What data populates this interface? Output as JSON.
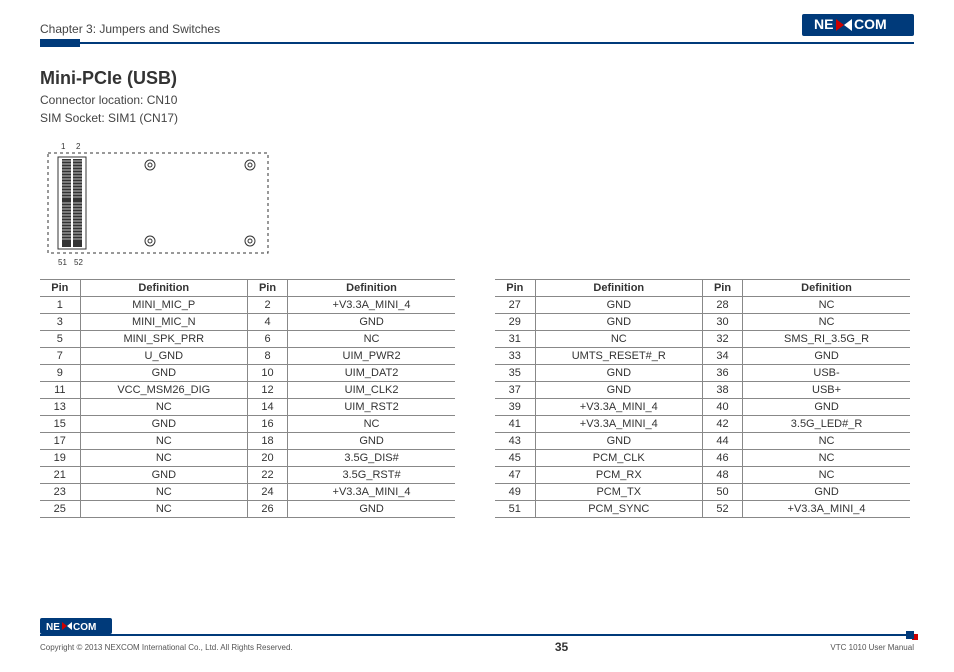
{
  "header": {
    "chapter_title": "Chapter 3: Jumpers and Switches",
    "logo_text": "NEXCOM"
  },
  "section": {
    "title": "Mini-PCIe (USB)",
    "connector_line": "Connector location: CN10",
    "sim_line": "SIM Socket: SIM1 (CN17)"
  },
  "diagram": {
    "label_top_1": "1",
    "label_top_2": "2",
    "label_bot_1": "51",
    "label_bot_2": "52"
  },
  "table_headers": {
    "pin": "Pin",
    "definition": "Definition"
  },
  "table1_rows": [
    {
      "p1": "1",
      "d1": "MINI_MIC_P",
      "p2": "2",
      "d2": "+V3.3A_MINI_4"
    },
    {
      "p1": "3",
      "d1": "MINI_MIC_N",
      "p2": "4",
      "d2": "GND"
    },
    {
      "p1": "5",
      "d1": "MINI_SPK_PRR",
      "p2": "6",
      "d2": "NC"
    },
    {
      "p1": "7",
      "d1": "U_GND",
      "p2": "8",
      "d2": "UIM_PWR2"
    },
    {
      "p1": "9",
      "d1": "GND",
      "p2": "10",
      "d2": "UIM_DAT2"
    },
    {
      "p1": "11",
      "d1": "VCC_MSM26_DIG",
      "p2": "12",
      "d2": "UIM_CLK2"
    },
    {
      "p1": "13",
      "d1": "NC",
      "p2": "14",
      "d2": "UIM_RST2"
    },
    {
      "p1": "15",
      "d1": "GND",
      "p2": "16",
      "d2": "NC"
    },
    {
      "p1": "17",
      "d1": "NC",
      "p2": "18",
      "d2": "GND"
    },
    {
      "p1": "19",
      "d1": "NC",
      "p2": "20",
      "d2": "3.5G_DIS#"
    },
    {
      "p1": "21",
      "d1": "GND",
      "p2": "22",
      "d2": "3.5G_RST#"
    },
    {
      "p1": "23",
      "d1": "NC",
      "p2": "24",
      "d2": "+V3.3A_MINI_4"
    },
    {
      "p1": "25",
      "d1": "NC",
      "p2": "26",
      "d2": "GND"
    }
  ],
  "table2_rows": [
    {
      "p1": "27",
      "d1": "GND",
      "p2": "28",
      "d2": "NC"
    },
    {
      "p1": "29",
      "d1": "GND",
      "p2": "30",
      "d2": "NC"
    },
    {
      "p1": "31",
      "d1": "NC",
      "p2": "32",
      "d2": "SMS_RI_3.5G_R"
    },
    {
      "p1": "33",
      "d1": "UMTS_RESET#_R",
      "p2": "34",
      "d2": "GND"
    },
    {
      "p1": "35",
      "d1": "GND",
      "p2": "36",
      "d2": "USB-"
    },
    {
      "p1": "37",
      "d1": "GND",
      "p2": "38",
      "d2": "USB+"
    },
    {
      "p1": "39",
      "d1": "+V3.3A_MINI_4",
      "p2": "40",
      "d2": "GND"
    },
    {
      "p1": "41",
      "d1": "+V3.3A_MINI_4",
      "p2": "42",
      "d2": "3.5G_LED#_R"
    },
    {
      "p1": "43",
      "d1": "GND",
      "p2": "44",
      "d2": "NC"
    },
    {
      "p1": "45",
      "d1": "PCM_CLK",
      "p2": "46",
      "d2": "NC"
    },
    {
      "p1": "47",
      "d1": "PCM_RX",
      "p2": "48",
      "d2": "NC"
    },
    {
      "p1": "49",
      "d1": "PCM_TX",
      "p2": "50",
      "d2": "GND"
    },
    {
      "p1": "51",
      "d1": "PCM_SYNC",
      "p2": "52",
      "d2": "+V3.3A_MINI_4"
    }
  ],
  "footer": {
    "copyright": "Copyright © 2013 NEXCOM International Co., Ltd. All Rights Reserved.",
    "page_number": "35",
    "manual_name": "VTC 1010 User Manual",
    "logo_text": "NEXCOM"
  }
}
